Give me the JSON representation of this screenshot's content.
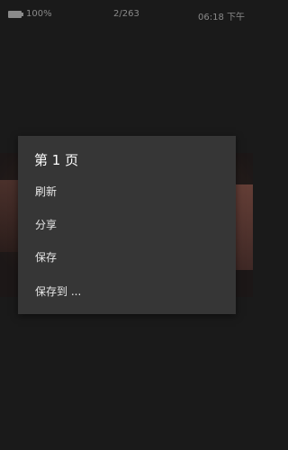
{
  "status_bar": {
    "battery_icon": "battery-icon",
    "battery_text": "100%",
    "page_counter": "2/263",
    "time": "06:18 下午"
  },
  "menu": {
    "title": "第 1 页",
    "items": [
      {
        "label": "刷新"
      },
      {
        "label": "分享"
      },
      {
        "label": "保存"
      },
      {
        "label": "保存到 ..."
      }
    ]
  }
}
